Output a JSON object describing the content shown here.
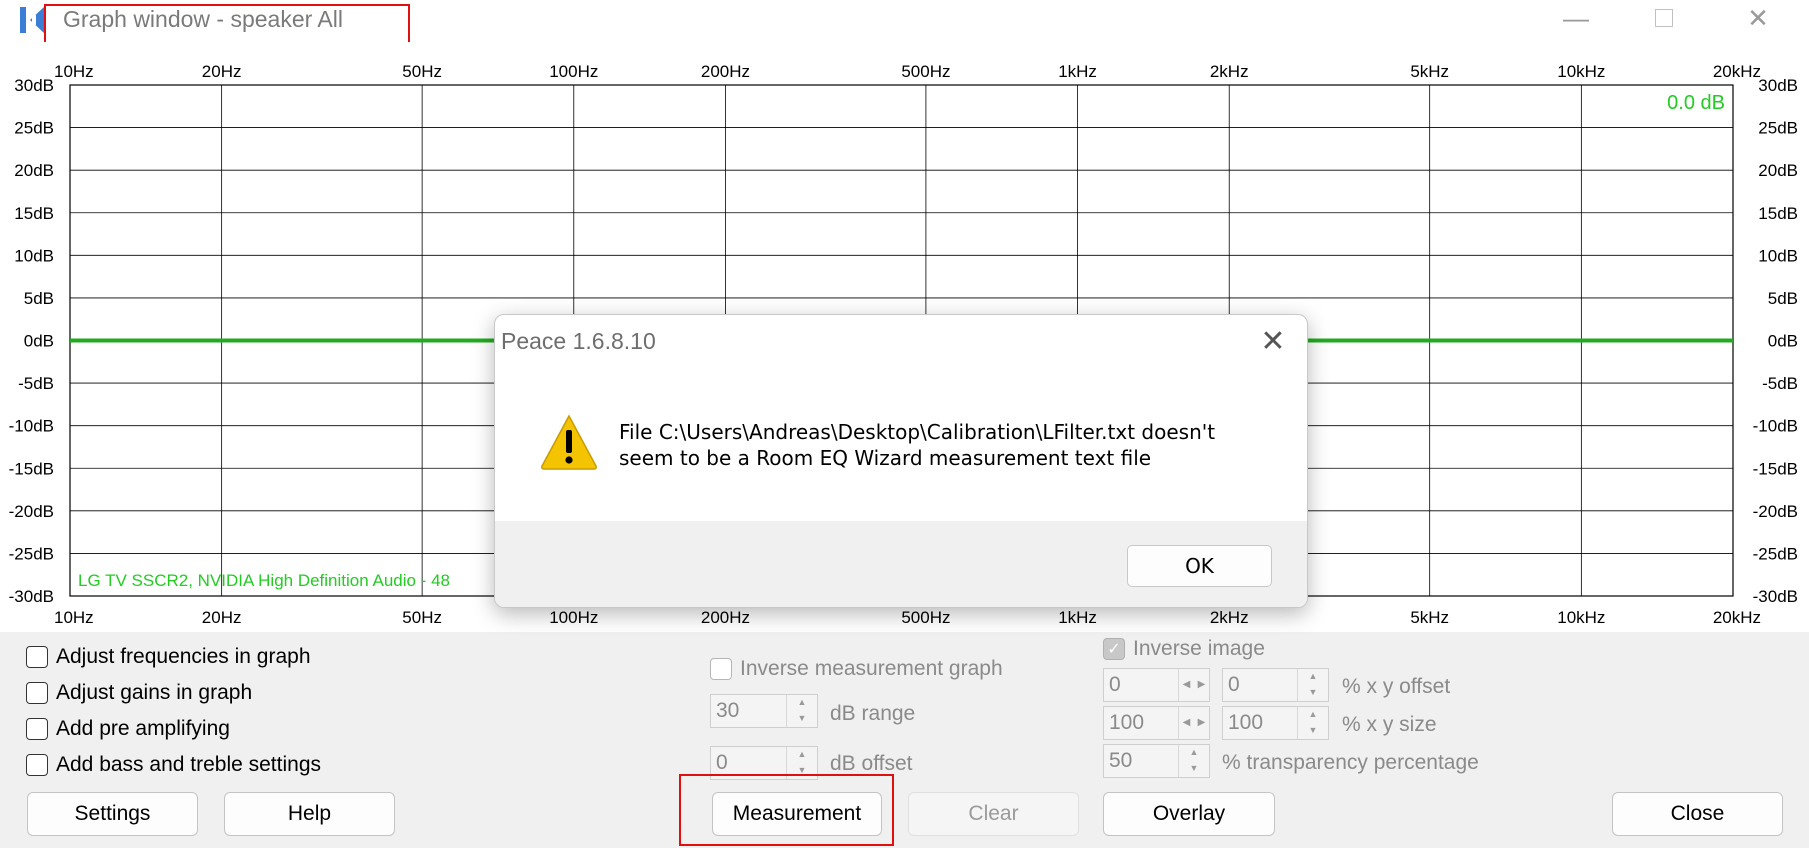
{
  "window": {
    "title": "Graph window - speaker All",
    "minimize_icon": "minimize-icon",
    "maximize_icon": "maximize-icon",
    "close_icon": "close-icon"
  },
  "graph": {
    "freq_labels": [
      "10Hz",
      "20Hz",
      "50Hz",
      "100Hz",
      "200Hz",
      "500Hz",
      "1kHz",
      "2kHz",
      "5kHz",
      "10kHz",
      "20kHz"
    ],
    "freq_values": [
      10,
      20,
      50,
      100,
      200,
      500,
      1000,
      2000,
      5000,
      10000,
      20000
    ],
    "db_labels": [
      "30dB",
      "25dB",
      "20dB",
      "15dB",
      "10dB",
      "5dB",
      "0dB",
      "-5dB",
      "-10dB",
      "-15dB",
      "-20dB",
      "-25dB",
      "-30dB"
    ],
    "db_range": [
      -30,
      30
    ],
    "gain_readout": "0.0 dB",
    "device_label": "LG TV SSCR2, NVIDIA High Definition Audio - 48",
    "curve_gain_db": 0,
    "curve_color": "#22aa22",
    "grid_color": "#000000"
  },
  "options": {
    "adjust_frequencies": "Adjust frequencies in graph",
    "adjust_gains": "Adjust gains in graph",
    "add_pre_amplifying": "Add pre amplifying",
    "add_bass_treble": "Add bass and treble settings"
  },
  "measurement": {
    "inverse_graph_label": "Inverse measurement graph",
    "db_range_value": "30",
    "db_range_label": "dB range",
    "db_offset_value": "0",
    "db_offset_label": "dB offset"
  },
  "image": {
    "inverse_image_label": "Inverse image",
    "x_offset": "0",
    "y_offset": "0",
    "offset_label": "% x y offset",
    "x_size": "100",
    "y_size": "100",
    "size_label": "% x y size",
    "transparency": "50",
    "transparency_label": "% transparency percentage"
  },
  "buttons": {
    "settings": "Settings",
    "help": "Help",
    "measurement": "Measurement",
    "clear": "Clear",
    "overlay": "Overlay",
    "close": "Close"
  },
  "dialog": {
    "title": "Peace 1.6.8.10",
    "message_line1": "File C:\\Users\\Andreas\\Desktop\\Calibration\\LFilter.txt doesn't",
    "message_line2": "seem to be a Room EQ Wizard measurement text file",
    "ok": "OK",
    "icon": "warning-icon",
    "warning_color": "#f5c400"
  },
  "highlight_color": "#e01010"
}
